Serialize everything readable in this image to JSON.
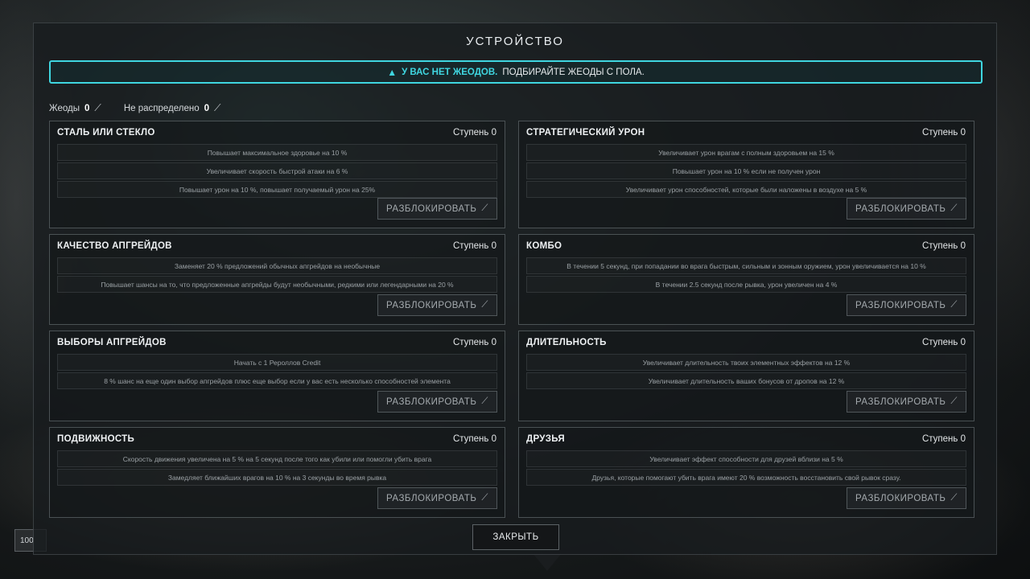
{
  "badge": "100",
  "title": "УСТРОЙСТВО",
  "alert": {
    "icon": "warning-icon",
    "strong": "У ВАС НЕТ ЖЕОДОВ.",
    "text": "ПОДБИРАЙТЕ ЖЕОДЫ С ПОЛА."
  },
  "counters": {
    "geodes_label": "Жеоды",
    "geodes_value": "0",
    "unassigned_label": "Не распределено",
    "unassigned_value": "0"
  },
  "unlock_label": "РАЗБЛОКИРОВАТЬ",
  "close_label": "ЗАКРЫТЬ",
  "cards": [
    {
      "name": "СТАЛЬ ИЛИ СТЕКЛО",
      "stage": "Ступень 0",
      "rows": [
        "Повышает максимальное здоровье на 10 %",
        "Увеличивает скорость быстрой атаки на 6 %",
        "Повышает урон на 10 %, повышает получаемый урон на 25%"
      ]
    },
    {
      "name": "СТРАТЕГИЧЕСКИЙ УРОН",
      "stage": "Ступень 0",
      "rows": [
        "Увеличивает урон врагам с полным здоровьем на 15 %",
        "Повышает урон на 10 % если не получен урон",
        "Увеличивает урон способностей, которые были наложены в воздухе на 5 %"
      ]
    },
    {
      "name": "КАЧЕСТВО АПГРЕЙДОВ",
      "stage": "Ступень 0",
      "rows": [
        "Заменяет 20 % предложений обычных апгрейдов на необычные",
        "Повышает шансы на то, что предложенные апгрейды будут необычными, редкими или легендарными на 20 %"
      ]
    },
    {
      "name": "КОМБО",
      "stage": "Ступень 0",
      "rows": [
        "В течении 5 секунд, при попадании во врага быстрым, сильным и зонным оружием, урон увеличивается на 10 %",
        "В течении 2.5 секунд после рывка, урон увеличен на 4 %"
      ]
    },
    {
      "name": "ВЫБОРЫ АПГРЕЙДОВ",
      "stage": "Ступень 0",
      "rows": [
        "Начать с 1 Рероллов Credit",
        "8 % шанс на еще один выбор апгрейдов плюс еще выбор если у вас есть несколько способностей элемента"
      ]
    },
    {
      "name": "ДЛИТЕЛЬНОСТЬ",
      "stage": "Ступень 0",
      "rows": [
        "Увеличивает длительность твоих элементных эффектов на 12 %",
        "Увеличивает длительность ваших бонусов от дропов на 12 %"
      ]
    },
    {
      "name": "ПОДВИЖНОСТЬ",
      "stage": "Ступень 0",
      "rows": [
        "Скорость движения увеличена на 5 % на 5 секунд после того как убили или помогли убить врага",
        "Замедляет ближайших врагов на 10 % на 3 секунды во время рывка"
      ]
    },
    {
      "name": "ДРУЗЬЯ",
      "stage": "Ступень 0",
      "rows": [
        "Увеличивает эффект способности для друзей вблизи на 5 %",
        "Друзья, которые помогают убить врага имеют 20 % возможность восстановить свой рывок сразу."
      ]
    }
  ]
}
